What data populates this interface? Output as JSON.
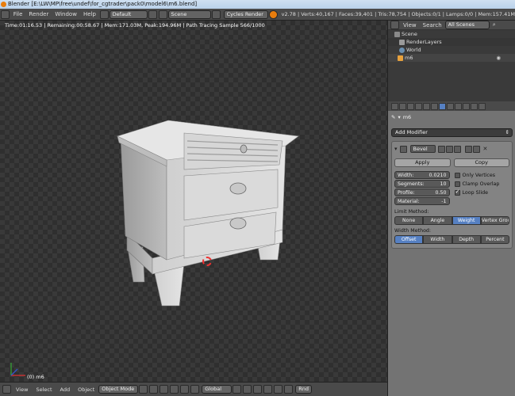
{
  "window": {
    "title": "Blender [E:\\LW\\MP\\free\\undef\\for_cgtrader\\pack0\\model6\\m6.blend]"
  },
  "topbar": {
    "menus": [
      "File",
      "Render",
      "Window",
      "Help"
    ],
    "layout": "Default",
    "scene": "Scene",
    "engine": "Cycles Render",
    "stats": "v2.78 | Verts:40,167 | Faces:39,401 | Tris:78,754 | Objects:0/1 | Lamps:0/0 | Mem:157.41M"
  },
  "viewport": {
    "status": "Time:01:16.53 | Remaining:00:58.67 | Mem:171.03M, Peak:194.96M | Path Tracing Sample 566/1000",
    "object_label": "(0) m6"
  },
  "bottombar": {
    "menus": [
      "View",
      "Select",
      "Add",
      "Object"
    ],
    "mode": "Object Mode",
    "orientation": "Global",
    "extra": "Rnd"
  },
  "outliner": {
    "menus": [
      "View",
      "Search"
    ],
    "scenes_dropdown": "All Scenes",
    "items": [
      {
        "label": "Scene"
      },
      {
        "label": "RenderLayers"
      },
      {
        "label": "World"
      },
      {
        "label": "m6"
      }
    ]
  },
  "properties": {
    "object_name": "m6",
    "add_modifier": "Add Modifier",
    "modifier": {
      "name": "Bevel",
      "apply": "Apply",
      "copy": "Copy",
      "width_label": "Width:",
      "width_value": "0.0210",
      "segments_label": "Segments:",
      "segments_value": "10",
      "profile_label": "Profile:",
      "profile_value": "0.50",
      "material_label": "Material:",
      "material_value": "-1",
      "only_vertices": "Only Vertices",
      "clamp_overlap": "Clamp Overlap",
      "loop_slide": "Loop Slide",
      "limit_method_label": "Limit Method:",
      "limit_methods": [
        "None",
        "Angle",
        "Weight",
        "Vertex Group"
      ],
      "limit_selected": "Weight",
      "width_method_label": "Width Method:",
      "width_methods": [
        "Offset",
        "Width",
        "Depth",
        "Percent"
      ],
      "width_selected": "Offset"
    }
  },
  "colors": {
    "accent": "#5680c2",
    "blender_orange": "#e87d0d"
  }
}
